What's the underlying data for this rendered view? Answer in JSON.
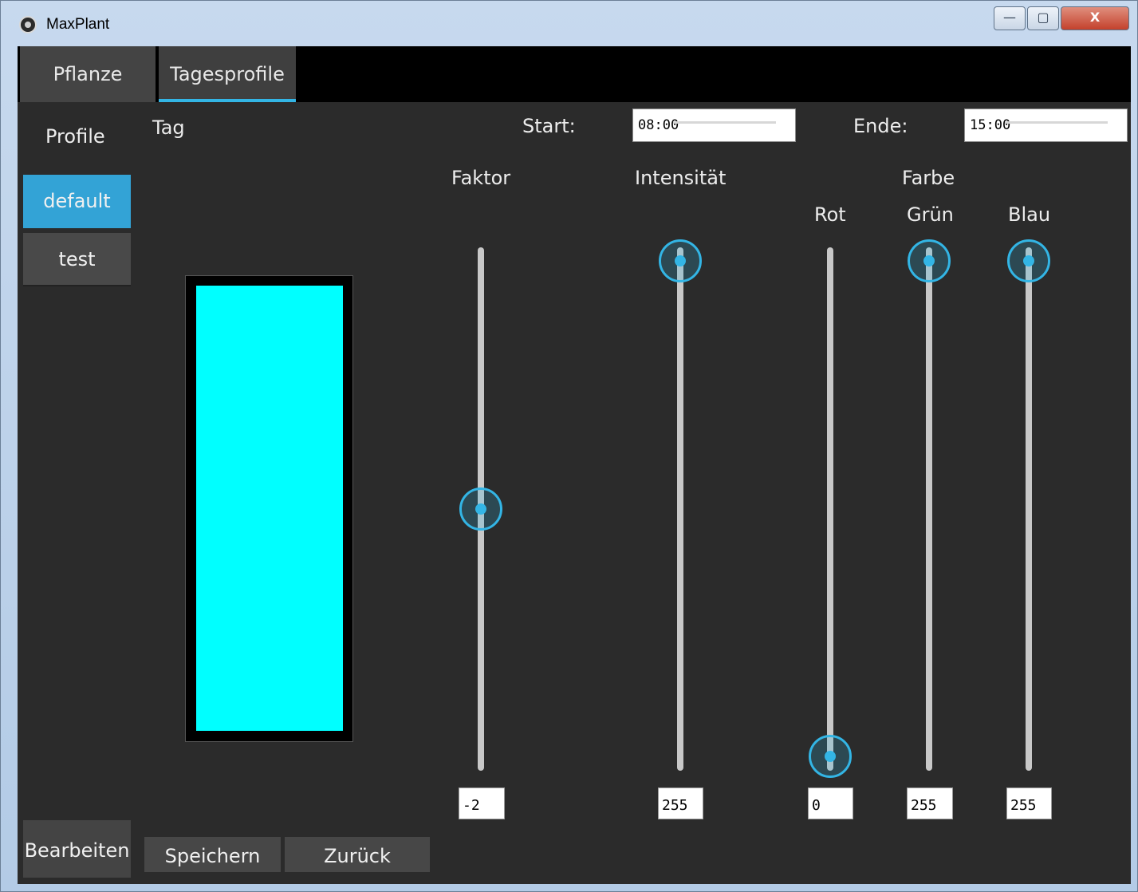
{
  "window": {
    "title": "MaxPlant",
    "minimize_label": "—",
    "maximize_label": "▢",
    "close_label": "X"
  },
  "tabs": [
    {
      "label": "Pflanze"
    },
    {
      "label": "Tagesprofile"
    }
  ],
  "sidebar": {
    "heading": "Profile",
    "profiles": [
      {
        "label": "default",
        "selected": true
      },
      {
        "label": "test",
        "selected": false
      }
    ],
    "edit_label": "Bearbeiten"
  },
  "day": {
    "tag_label": "Tag",
    "start_label": "Start:",
    "start_value": "08:00",
    "end_label": "Ende:",
    "end_value": "15:00",
    "preview_color": "#00ffff"
  },
  "controls": {
    "faktor": {
      "label": "Faktor",
      "value": "-2",
      "level": 0.5
    },
    "intensitaet": {
      "label": "Intensität",
      "value": "255",
      "level": 1.0
    },
    "farbe_label": "Farbe",
    "rot": {
      "label": "Rot",
      "value": "0",
      "level": 0.0
    },
    "gruen": {
      "label": "Grün",
      "value": "255",
      "level": 1.0
    },
    "blau": {
      "label": "Blau",
      "value": "255",
      "level": 1.0
    }
  },
  "actions": {
    "save_label": "Speichern",
    "back_label": "Zurück"
  },
  "colors": {
    "accent": "#33b5e5",
    "background": "#2b2b2b"
  }
}
